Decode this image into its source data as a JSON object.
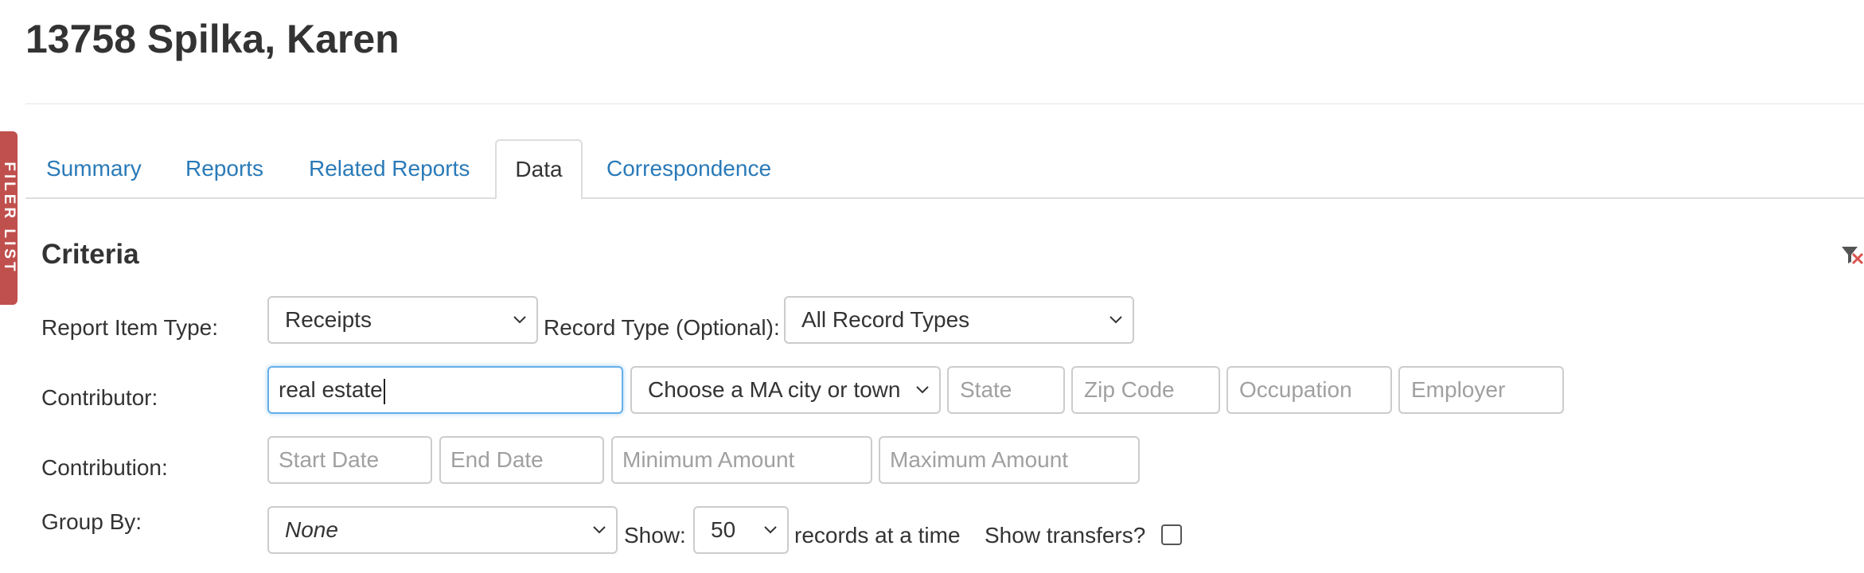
{
  "page": {
    "title": "13758 Spilka, Karen"
  },
  "side_tab": {
    "label": "FILER LIST"
  },
  "tabs": [
    {
      "label": "Summary"
    },
    {
      "label": "Reports"
    },
    {
      "label": "Related Reports"
    },
    {
      "label": "Data"
    },
    {
      "label": "Correspondence"
    }
  ],
  "active_tab": "Data",
  "criteria": {
    "heading": "Criteria",
    "filter_icon": "filter-clear-icon",
    "report_item_type": {
      "label": "Report Item Type:",
      "value": "Receipts"
    },
    "record_type": {
      "label": "Record Type (Optional):",
      "value": "All Record Types"
    },
    "contributor": {
      "label": "Contributor:",
      "name_value": "real estate",
      "city_value": "Choose a MA city or town",
      "state_placeholder": "State",
      "zip_placeholder": "Zip Code",
      "occupation_placeholder": "Occupation",
      "employer_placeholder": "Employer"
    },
    "contribution": {
      "label": "Contribution:",
      "start_placeholder": "Start Date",
      "end_placeholder": "End Date",
      "min_placeholder": "Minimum Amount",
      "max_placeholder": "Maximum Amount"
    },
    "group_by": {
      "label": "Group By:",
      "value": "None"
    },
    "show": {
      "label": "Show:",
      "value": "50",
      "suffix": "records at a time"
    },
    "show_transfers": {
      "label": "Show transfers?",
      "checked": false
    }
  },
  "colors": {
    "link": "#2a7ab8",
    "side_tab": "#c0504d",
    "focus": "#66afe9"
  }
}
